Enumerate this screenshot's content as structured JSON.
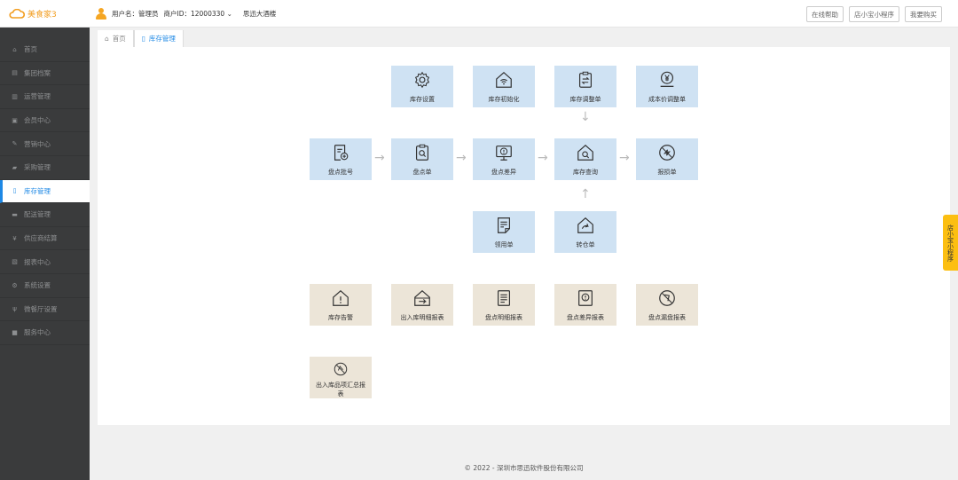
{
  "header": {
    "logo_text": "美食家3",
    "user_label": "用户名：管理员",
    "merchant_label": "商户ID：12000330",
    "merchant_chevron": "⌄",
    "shop_name": "思迅大酒楼",
    "buttons": [
      "在线帮助",
      "店小宝小程序",
      "我要购买"
    ]
  },
  "sidebar": {
    "items": [
      {
        "label": "首页",
        "icon": "home-icon",
        "glyph": "⌂"
      },
      {
        "label": "集团档案",
        "icon": "archive-icon",
        "glyph": "▤"
      },
      {
        "label": "运营管理",
        "icon": "bar-chart-icon",
        "glyph": "▥"
      },
      {
        "label": "会员中心",
        "icon": "id-card-icon",
        "glyph": "▣"
      },
      {
        "label": "营销中心",
        "icon": "edit-icon",
        "glyph": "✎"
      },
      {
        "label": "采购管理",
        "icon": "book-icon",
        "glyph": "▰"
      },
      {
        "label": "库存管理",
        "icon": "file-icon",
        "glyph": "▯"
      },
      {
        "label": "配送管理",
        "icon": "truck-icon",
        "glyph": "▬"
      },
      {
        "label": "供应商结算",
        "icon": "yen-icon",
        "glyph": "¥"
      },
      {
        "label": "报表中心",
        "icon": "report-icon",
        "glyph": "▧"
      },
      {
        "label": "系统设置",
        "icon": "gears-icon",
        "glyph": "⚙"
      },
      {
        "label": "微餐厅设置",
        "icon": "fork-knife-icon",
        "glyph": "ψ"
      },
      {
        "label": "服务中心",
        "icon": "service-icon",
        "glyph": "■"
      }
    ],
    "active_index": 6
  },
  "tabs": [
    {
      "label": "首页",
      "icon": "home-icon"
    },
    {
      "label": "库存管理",
      "icon": "file-icon"
    }
  ],
  "tiles": {
    "inv_settings": {
      "label": "库存设置",
      "icon": "gear-icon"
    },
    "inv_init": {
      "label": "库存初始化",
      "icon": "house-wifi-icon"
    },
    "inv_adjust": {
      "label": "库存调整单",
      "icon": "clipboard-swap-icon"
    },
    "cost_adjust": {
      "label": "成本价调整单",
      "icon": "yen-coin-icon"
    },
    "count_batch": {
      "label": "盘点批号",
      "icon": "doc-plus-icon"
    },
    "count_sheet": {
      "label": "盘点单",
      "icon": "clipboard-search-icon"
    },
    "count_diff": {
      "label": "盘点差异",
      "icon": "monitor-alert-icon"
    },
    "inv_query": {
      "label": "库存查询",
      "icon": "house-search-icon"
    },
    "loss_report": {
      "label": "报损单",
      "icon": "broken-icon"
    },
    "requisition": {
      "label": "领用单",
      "icon": "doc-lines-icon"
    },
    "transfer": {
      "label": "转仓单",
      "icon": "house-arrow-icon"
    },
    "inv_alert": {
      "label": "库存告警",
      "icon": "house-alert-icon"
    },
    "io_detail": {
      "label": "出入库明细报表",
      "icon": "house-exit-icon"
    },
    "count_detail": {
      "label": "盘点明细报表",
      "icon": "doc-list-icon"
    },
    "count_diff_report": {
      "label": "盘点差异报表",
      "icon": "box-alert-icon"
    },
    "count_miss_report": {
      "label": "盘点漏盘报表",
      "icon": "circle-slash-icon"
    },
    "io_summary": {
      "label": "出入库品项汇总报表",
      "icon": "circle-slash2-icon"
    }
  },
  "mini_tag": "店小宝小程序",
  "footer": "© 2022 - 深圳市思迅软件股份有限公司"
}
